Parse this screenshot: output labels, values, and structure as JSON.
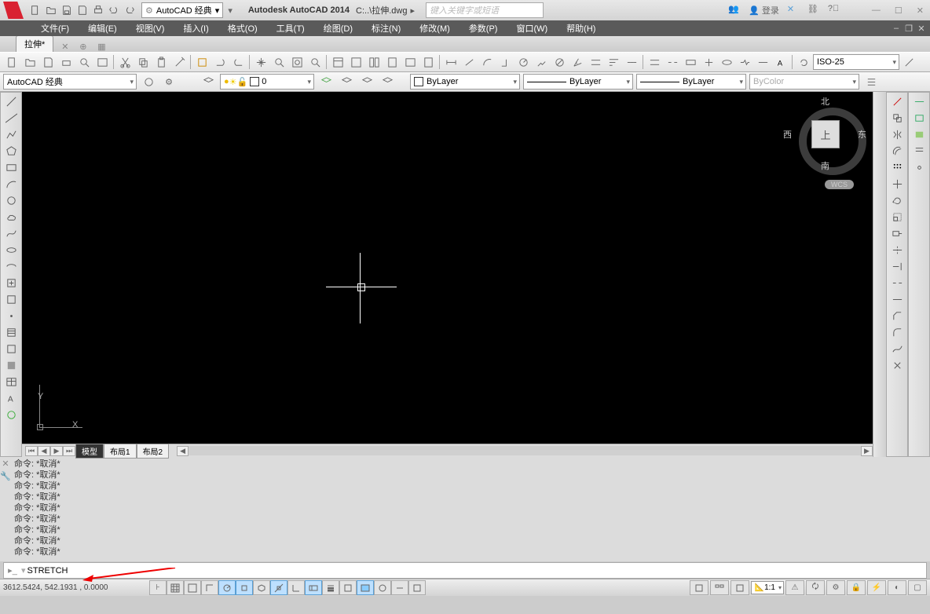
{
  "title": {
    "app": "Autodesk AutoCAD 2014",
    "file": "C:..\\拉伸.dwg",
    "workspace": "AutoCAD 经典"
  },
  "search": {
    "placeholder": "键入关键字或短语"
  },
  "title_right": {
    "login": "登录"
  },
  "menu": {
    "items": [
      "文件(F)",
      "编辑(E)",
      "视图(V)",
      "插入(I)",
      "格式(O)",
      "工具(T)",
      "绘图(D)",
      "标注(N)",
      "修改(M)",
      "参数(P)",
      "窗口(W)",
      "帮助(H)"
    ]
  },
  "tab": {
    "active": "拉伸*"
  },
  "prop": {
    "workspace": "AutoCAD 经典",
    "layer": "0",
    "bylayer1": "ByLayer",
    "bylayer2": "ByLayer",
    "bylayer3": "ByLayer",
    "bycolor": "ByColor",
    "dimstyle": "ISO-25"
  },
  "viewcube": {
    "face": "上",
    "n": "北",
    "s": "南",
    "e": "东",
    "w": "西",
    "badge": "WCS"
  },
  "ucs": {
    "y": "Y",
    "x": "X"
  },
  "layout": {
    "model": "模型",
    "l1": "布局1",
    "l2": "布局2"
  },
  "cmd": {
    "lines": [
      "命令: *取消*",
      "命令: *取消*",
      "命令: *取消*",
      "命令: *取消*",
      "命令: *取消*",
      "命令: *取消*",
      "命令: *取消*",
      "命令: *取消*",
      "命令: *取消*"
    ],
    "prompt": "STRETCH"
  },
  "status": {
    "coords": "3612.5424, 542.1931 , 0.0000",
    "scale": "1:1"
  }
}
